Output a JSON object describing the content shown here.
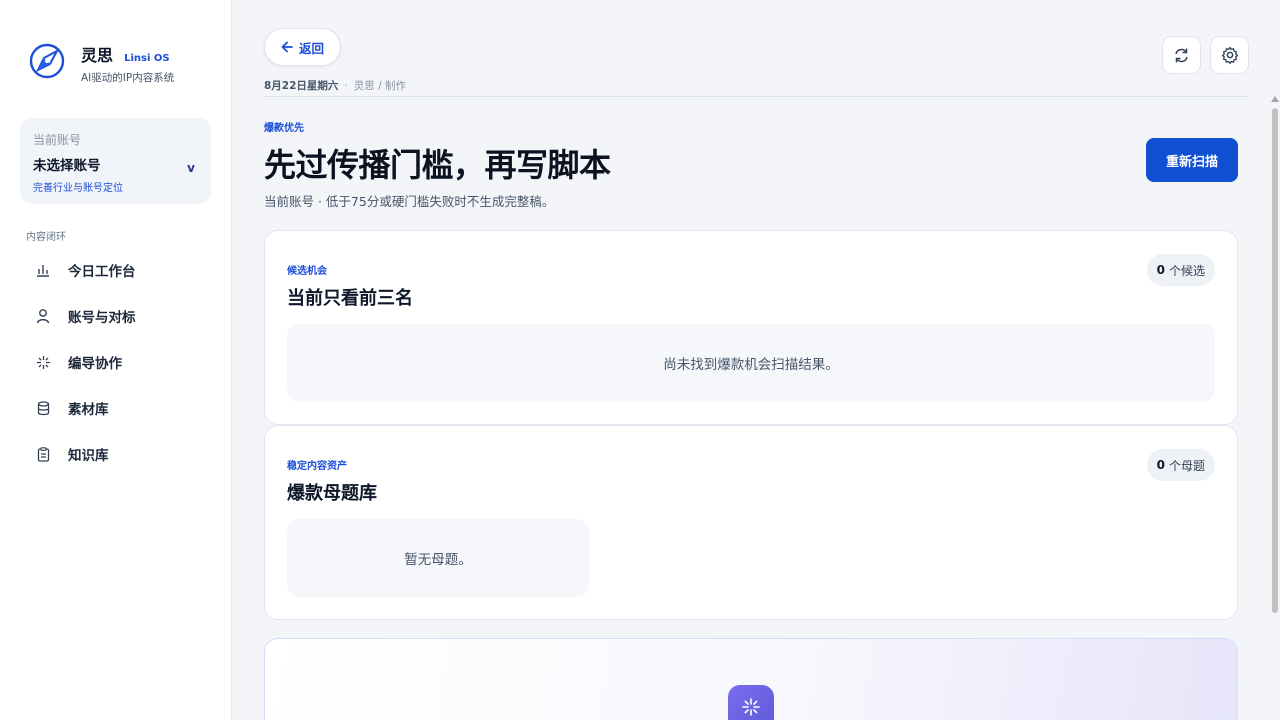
{
  "brand": {
    "name": "灵思",
    "name_en": "Linsi OS",
    "subtitle": "AI驱动的IP内容系统"
  },
  "account": {
    "label": "当前账号",
    "value": "未选择账号",
    "link": "完善行业与账号定位",
    "chevron": "v"
  },
  "nav": {
    "section": "内容闭环",
    "items": [
      {
        "label": "今日工作台",
        "icon": "bar-chart-icon"
      },
      {
        "label": "账号与对标",
        "icon": "user-icon"
      },
      {
        "label": "编导协作",
        "icon": "sparkle-icon"
      },
      {
        "label": "素材库",
        "icon": "database-icon"
      },
      {
        "label": "知识库",
        "icon": "clipboard-icon"
      }
    ]
  },
  "header": {
    "back_label": "返回",
    "date": "8月22日星期六",
    "separator": "·",
    "breadcrumb": "灵思 / 制作"
  },
  "page": {
    "eyebrow": "爆款优先",
    "title": "先过传播门槛，再写脚本",
    "subtitle": "当前账号 · 低于75分或硬门槛失败时不生成完整稿。",
    "rescan_label": "重新扫描"
  },
  "cards": {
    "candidates": {
      "eyebrow": "候选机会",
      "title": "当前只看前三名",
      "count": "0",
      "count_unit": "个候选",
      "empty": "尚未找到爆款机会扫描结果。"
    },
    "topics": {
      "eyebrow": "稳定内容资产",
      "title": "爆款母题库",
      "count": "0",
      "count_unit": "个母题",
      "empty": "暂无母题。"
    }
  },
  "colors": {
    "accent": "#1d4ed8",
    "primary_button": "#0f4fd1",
    "hero_badge": "#6d63e6"
  }
}
